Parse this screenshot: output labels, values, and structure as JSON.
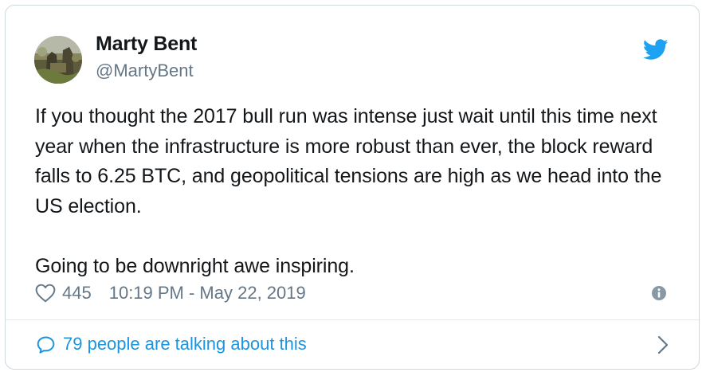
{
  "author": {
    "name": "Marty Bent",
    "handle": "@MartyBent"
  },
  "tweet": {
    "text": "If you thought the 2017 bull run was intense just wait until this time next year when the infrastructure is more robust than ever, the block reward falls to 6.25 BTC, and geopolitical tensions are high as we head into the US election.\n\nGoing to be downright awe inspiring.",
    "likes": "445",
    "timestamp": "10:19 PM - May 22, 2019"
  },
  "footer": {
    "talking": "79 people are talking about this"
  },
  "icons": {
    "brand": "twitter-bird-icon",
    "like": "heart-icon",
    "info": "info-icon",
    "comment": "comment-icon",
    "chevron": "chevron-right-icon"
  },
  "colors": {
    "brand": "#1da1f2",
    "link": "#1b95e0",
    "text": "#14171a",
    "secondary": "#657786",
    "border": "#cfd9de"
  }
}
